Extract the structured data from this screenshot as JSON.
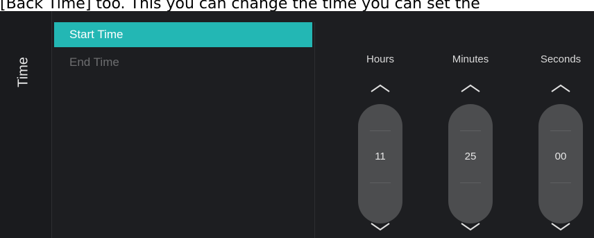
{
  "caption": "[Back Time] too. This you can change the time you can set the",
  "side_title": "Time",
  "menu": {
    "items": [
      {
        "label": "Start Time",
        "selected": true
      },
      {
        "label": "End Time",
        "selected": false
      }
    ]
  },
  "time_picker": {
    "columns": [
      {
        "label": "Hours",
        "value": "11"
      },
      {
        "label": "Minutes",
        "value": "25"
      },
      {
        "label": "Seconds",
        "value": "00"
      }
    ],
    "up_icon": "chevron-up-icon",
    "down_icon": "chevron-down-icon"
  },
  "colors": {
    "accent": "#23b7b4",
    "background": "#1d1e21",
    "spinner": "#4c4d4f"
  }
}
